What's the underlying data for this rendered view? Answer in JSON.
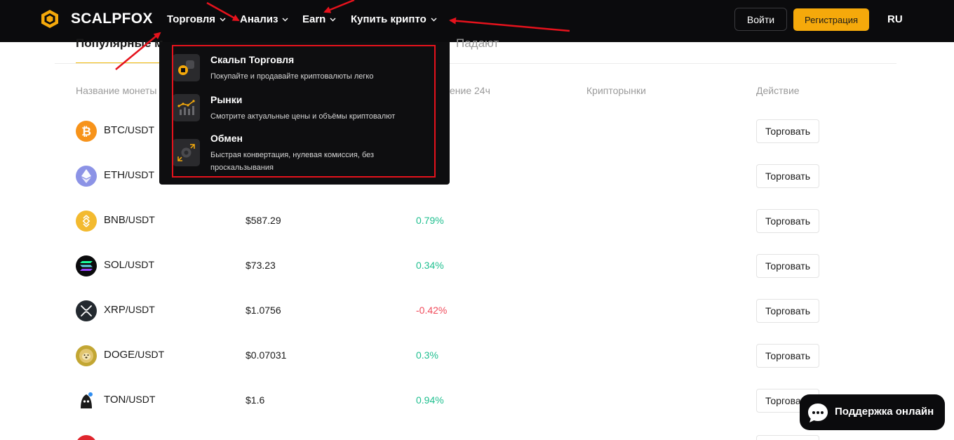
{
  "header": {
    "brand": "SCALPFOX",
    "nav": [
      {
        "label": "Торговля"
      },
      {
        "label": "Анализ"
      },
      {
        "label": "Earn"
      },
      {
        "label": "Купить крипто"
      }
    ],
    "login_label": "Войти",
    "register_label": "Регистрация",
    "language": "RU"
  },
  "tabs": {
    "active": "Популярные м",
    "falling": "Падают"
  },
  "table": {
    "headers": {
      "coin": "Название монеты",
      "change": "ение 24ч",
      "markets": "Крипторынки",
      "action": "Действие"
    },
    "rows": [
      {
        "base": "BTC",
        "quote": "/USDT",
        "price": "",
        "change": "",
        "trade": "Торговать"
      },
      {
        "base": "ETH",
        "quote": "/USDT",
        "price": "",
        "change": "",
        "trade": "Торговать"
      },
      {
        "base": "BNB",
        "quote": "/USDT",
        "price": "$587.29",
        "change": "0.79%",
        "trade": "Торговать"
      },
      {
        "base": "SOL",
        "quote": "/USDT",
        "price": "$73.23",
        "change": "0.34%",
        "trade": "Торговать"
      },
      {
        "base": "XRP",
        "quote": "/USDT",
        "price": "$1.0756",
        "change": "-0.42%",
        "trade": "Торговать"
      },
      {
        "base": "DOGE",
        "quote": "/USDT",
        "price": "$0.07031",
        "change": "0.3%",
        "trade": "Торговать"
      },
      {
        "base": "TON",
        "quote": "/USDT",
        "price": "$1.6",
        "change": "0.94%",
        "trade": "Торговать"
      }
    ]
  },
  "dropdown": {
    "items": [
      {
        "title": "Скальп Торговля",
        "desc": "Покупайте и продавайте криптовалюты легко"
      },
      {
        "title": "Рынки",
        "desc": "Смотрите актуальные цены и объёмы криптовалют"
      },
      {
        "title": "Обмен",
        "desc": "Быстрая конвертация, нулевая комиссия, без проскальзывания"
      }
    ]
  },
  "support": {
    "label": "Поддержка онлайн"
  },
  "colors": {
    "accent": "#f5a90b",
    "up": "#1fbf8f",
    "down": "#f04a5a",
    "annotation": "#e5121c"
  }
}
